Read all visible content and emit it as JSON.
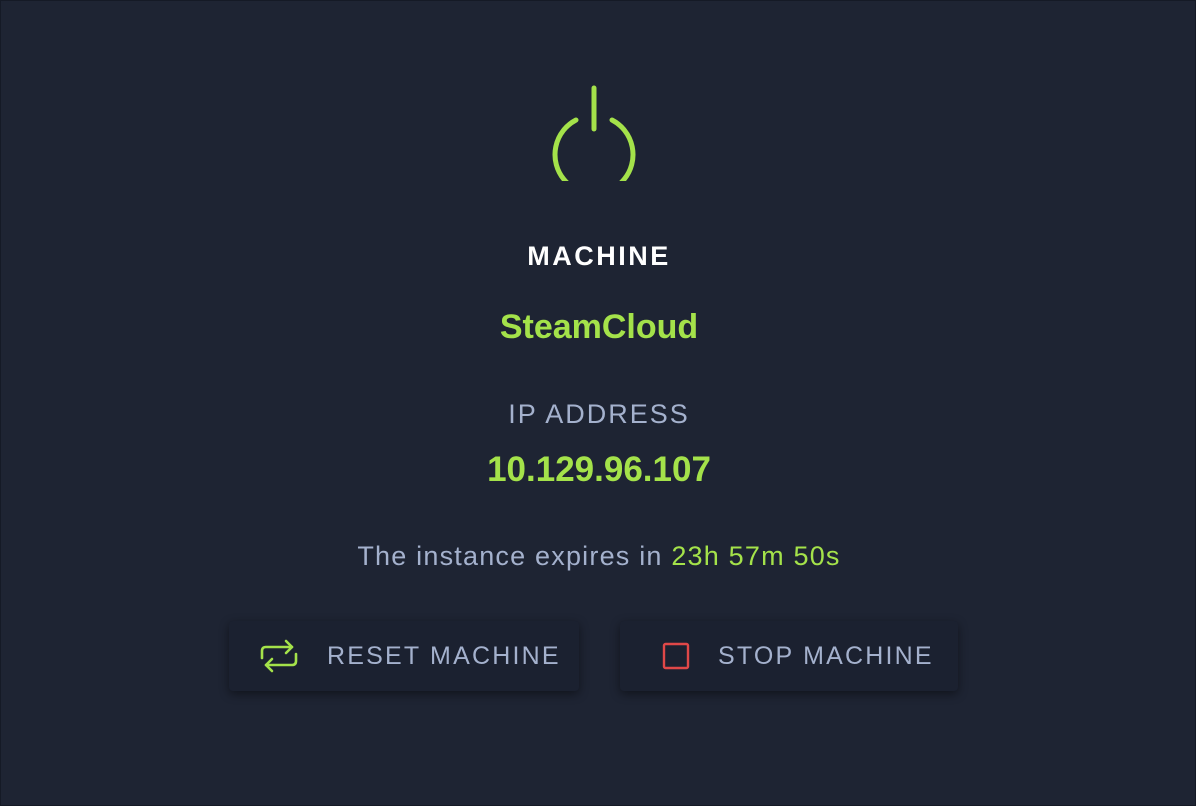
{
  "machine": {
    "status_icon": "power-icon",
    "heading": "MACHINE",
    "name": "SteamCloud",
    "ip_label": "IP ADDRESS",
    "ip_address": "10.129.96.107",
    "expires_prefix": "The instance expires in ",
    "expires_timer": "23h 57m 50s"
  },
  "actions": {
    "reset": {
      "label": "RESET MACHINE",
      "icon": "refresh-icon"
    },
    "stop": {
      "label": "STOP MACHINE",
      "icon": "stop-icon"
    }
  },
  "colors": {
    "background": "#1e2433",
    "accent": "#a4e24a",
    "muted_text": "#a4b1cd",
    "heading_text": "#ffffff",
    "stop_red": "#e04848"
  }
}
